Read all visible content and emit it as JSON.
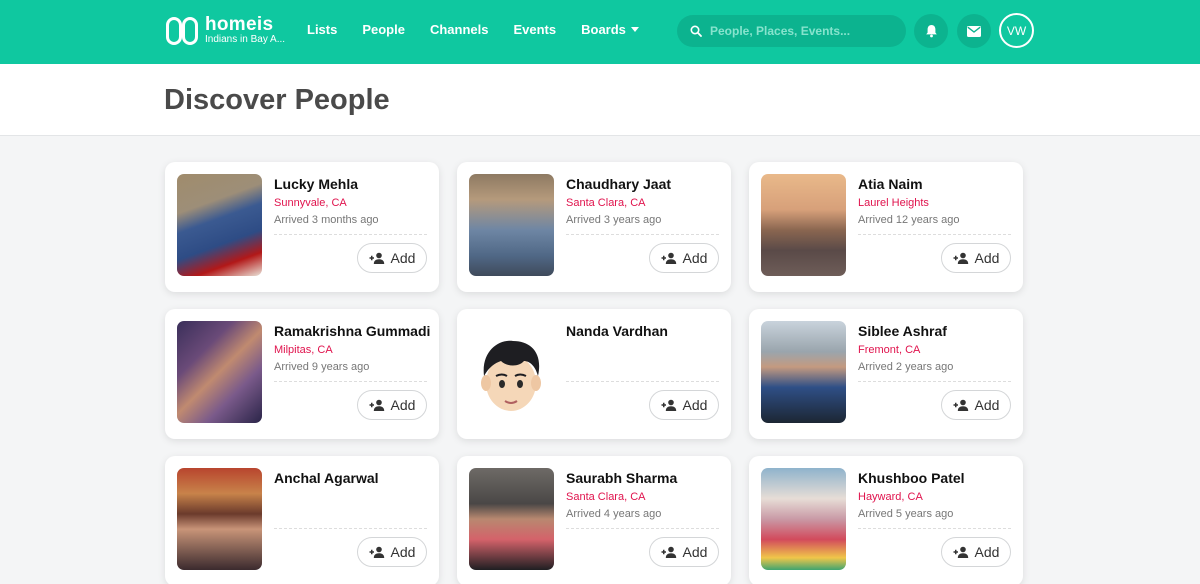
{
  "app": {
    "name": "homeis",
    "community": "Indians in Bay A..."
  },
  "nav": [
    {
      "label": "Lists"
    },
    {
      "label": "People"
    },
    {
      "label": "Channels"
    },
    {
      "label": "Events"
    },
    {
      "label": "Boards"
    }
  ],
  "search": {
    "placeholder": "People, Places, Events..."
  },
  "user": {
    "initials": "VW"
  },
  "page": {
    "title": "Discover People"
  },
  "add_label": "Add",
  "people": [
    {
      "name": "Lucky Mehla",
      "location": "Sunnyvale, CA",
      "arrived": "Arrived 3 months ago"
    },
    {
      "name": "Chaudhary Jaat",
      "location": "Santa Clara, CA",
      "arrived": "Arrived 3 years ago"
    },
    {
      "name": "Atia Naim",
      "location": "Laurel Heights",
      "arrived": "Arrived 12 years ago"
    },
    {
      "name": "Ramakrishna Gummadi",
      "location": "Milpitas, CA",
      "arrived": "Arrived 9 years ago"
    },
    {
      "name": "Nanda Vardhan",
      "location": "",
      "arrived": ""
    },
    {
      "name": "Siblee Ashraf",
      "location": "Fremont, CA",
      "arrived": "Arrived 2 years ago"
    },
    {
      "name": "Anchal Agarwal",
      "location": "",
      "arrived": ""
    },
    {
      "name": "Saurabh Sharma",
      "location": "Santa Clara, CA",
      "arrived": "Arrived 4 years ago"
    },
    {
      "name": "Khushboo Patel",
      "location": "Hayward, CA",
      "arrived": "Arrived 5 years ago"
    }
  ],
  "colors": {
    "brand": "#0fc8a0",
    "location": "#e0134d"
  }
}
